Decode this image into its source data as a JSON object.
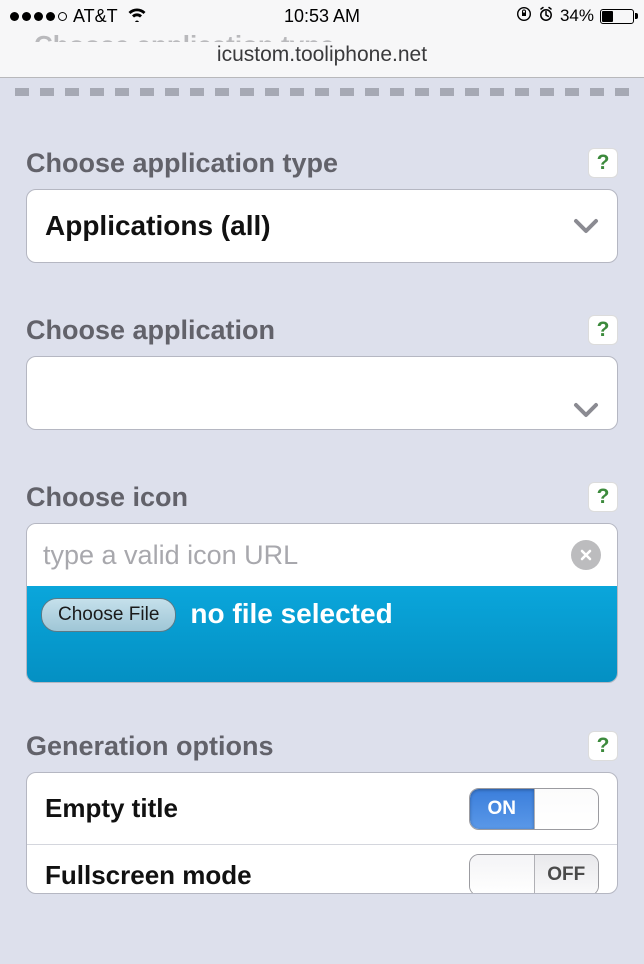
{
  "status_bar": {
    "carrier": "AT&T",
    "time": "10:53 AM",
    "battery_pct": "34%"
  },
  "nav": {
    "url": "icustom.tooliphone.net",
    "peek": "Choose application type"
  },
  "sections": {
    "app_type": {
      "label": "Choose application type",
      "value": "Applications (all)",
      "help": "?"
    },
    "app": {
      "label": "Choose application",
      "value": "",
      "help": "?"
    },
    "icon": {
      "label": "Choose icon",
      "placeholder": "type a valid icon URL",
      "choose_file": "Choose File",
      "file_status": "no file selected",
      "help": "?"
    },
    "options": {
      "label": "Generation options",
      "help": "?",
      "rows": {
        "empty_title": {
          "label": "Empty title",
          "on_text": "ON",
          "off_text": ""
        },
        "fullscreen": {
          "label": "Fullscreen mode",
          "on_text": "",
          "off_text": "OFF"
        }
      }
    }
  }
}
